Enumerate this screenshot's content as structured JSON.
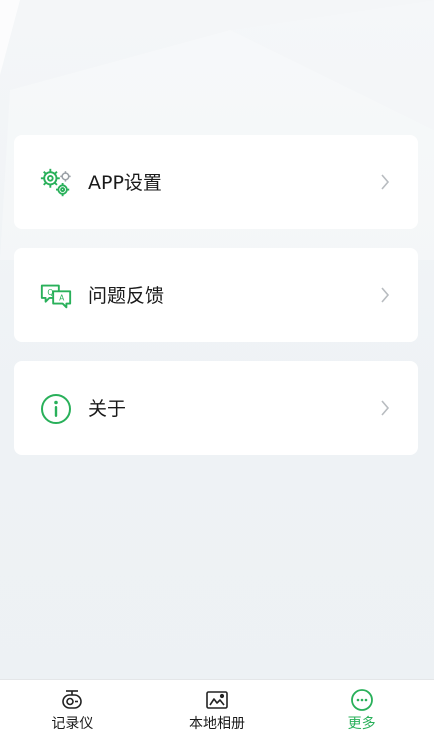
{
  "menu": {
    "items": [
      {
        "label": "APP设置",
        "icon": "gears-icon"
      },
      {
        "label": "问题反馈",
        "icon": "feedback-chat-icon"
      },
      {
        "label": "关于",
        "icon": "info-icon"
      }
    ]
  },
  "tabbar": {
    "tabs": [
      {
        "label": "记录仪",
        "icon": "dashcam-icon",
        "active": false
      },
      {
        "label": "本地相册",
        "icon": "album-icon",
        "active": false
      },
      {
        "label": "更多",
        "icon": "more-icon",
        "active": true
      }
    ]
  },
  "colors": {
    "accent": "#29b05a",
    "background": "#edf1f4",
    "card": "#ffffff",
    "chevron": "#b8bcc0"
  }
}
